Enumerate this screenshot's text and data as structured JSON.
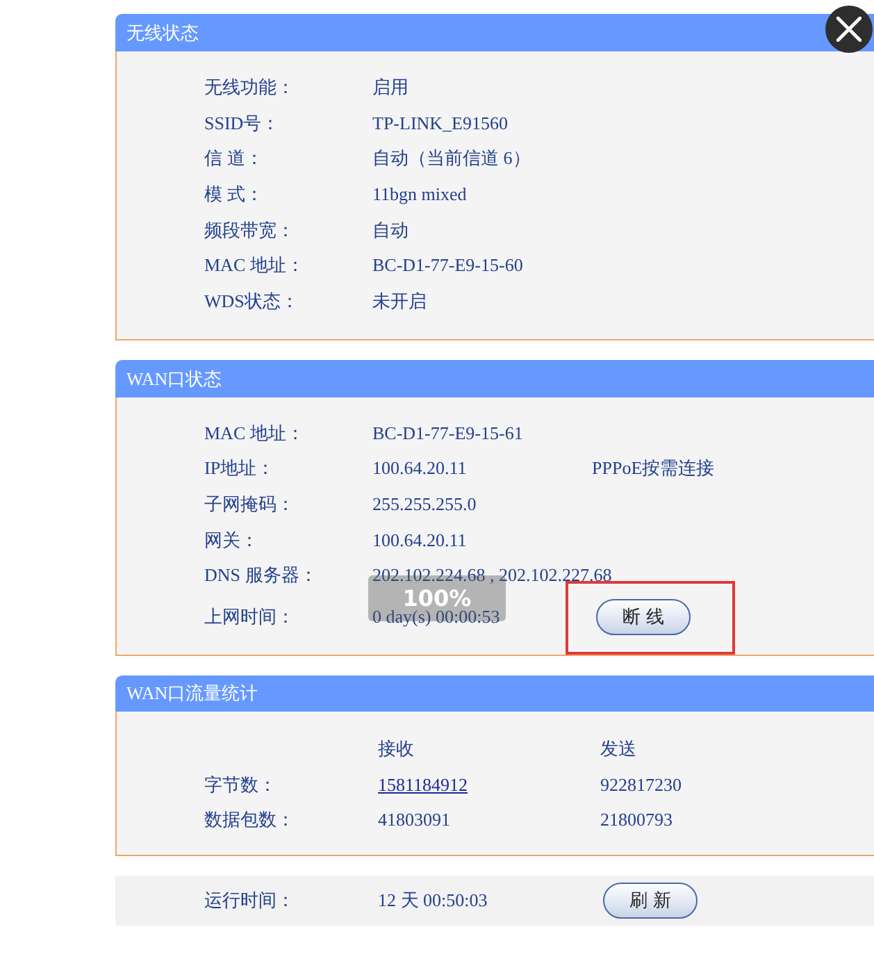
{
  "zoom_indicator": {
    "text": "100%"
  },
  "sections": [
    {
      "title": "无线状态",
      "rows": [
        {
          "label": "无线功能：",
          "value": "启用"
        },
        {
          "label": "SSID号：",
          "value": "TP-LINK_E91560"
        },
        {
          "label": "信 道：",
          "value": "自动（当前信道 6）"
        },
        {
          "label": "模 式：",
          "value": "11bgn mixed"
        },
        {
          "label": "频段带宽：",
          "value": "自动"
        },
        {
          "label": "MAC 地址：",
          "value": "BC-D1-77-E9-15-60"
        },
        {
          "label": "WDS状态：",
          "value": "未开启"
        }
      ]
    },
    {
      "title": "WAN口状态",
      "rows": [
        {
          "label": "MAC 地址：",
          "value": "BC-D1-77-E9-15-61"
        },
        {
          "label": "IP地址：",
          "value": "100.64.20.11",
          "extra": "PPPoE按需连接"
        },
        {
          "label": "子网掩码：",
          "value": "255.255.255.0"
        },
        {
          "label": "网关：",
          "value": "100.64.20.11"
        },
        {
          "label": "DNS 服务器：",
          "value": "202.102.224.68 , 202.102.227.68"
        },
        {
          "label": "上网时间：",
          "value": "0 day(s) 00:00:53",
          "button": "断 线"
        }
      ]
    }
  ],
  "traffic": {
    "title": "WAN口流量统计",
    "columns": [
      "接收",
      "发送"
    ],
    "rows": [
      {
        "label": "字节数：",
        "cells": [
          {
            "text": "1581184912",
            "link": true
          },
          {
            "text": "922817230",
            "link": false
          }
        ]
      },
      {
        "label": "数据包数：",
        "cells": [
          {
            "text": "41803091",
            "link": false
          },
          {
            "text": "21800793",
            "link": false
          }
        ]
      }
    ]
  },
  "footer": {
    "label": "运行时间：",
    "value": "12 天 00:50:03",
    "button": "刷 新"
  }
}
